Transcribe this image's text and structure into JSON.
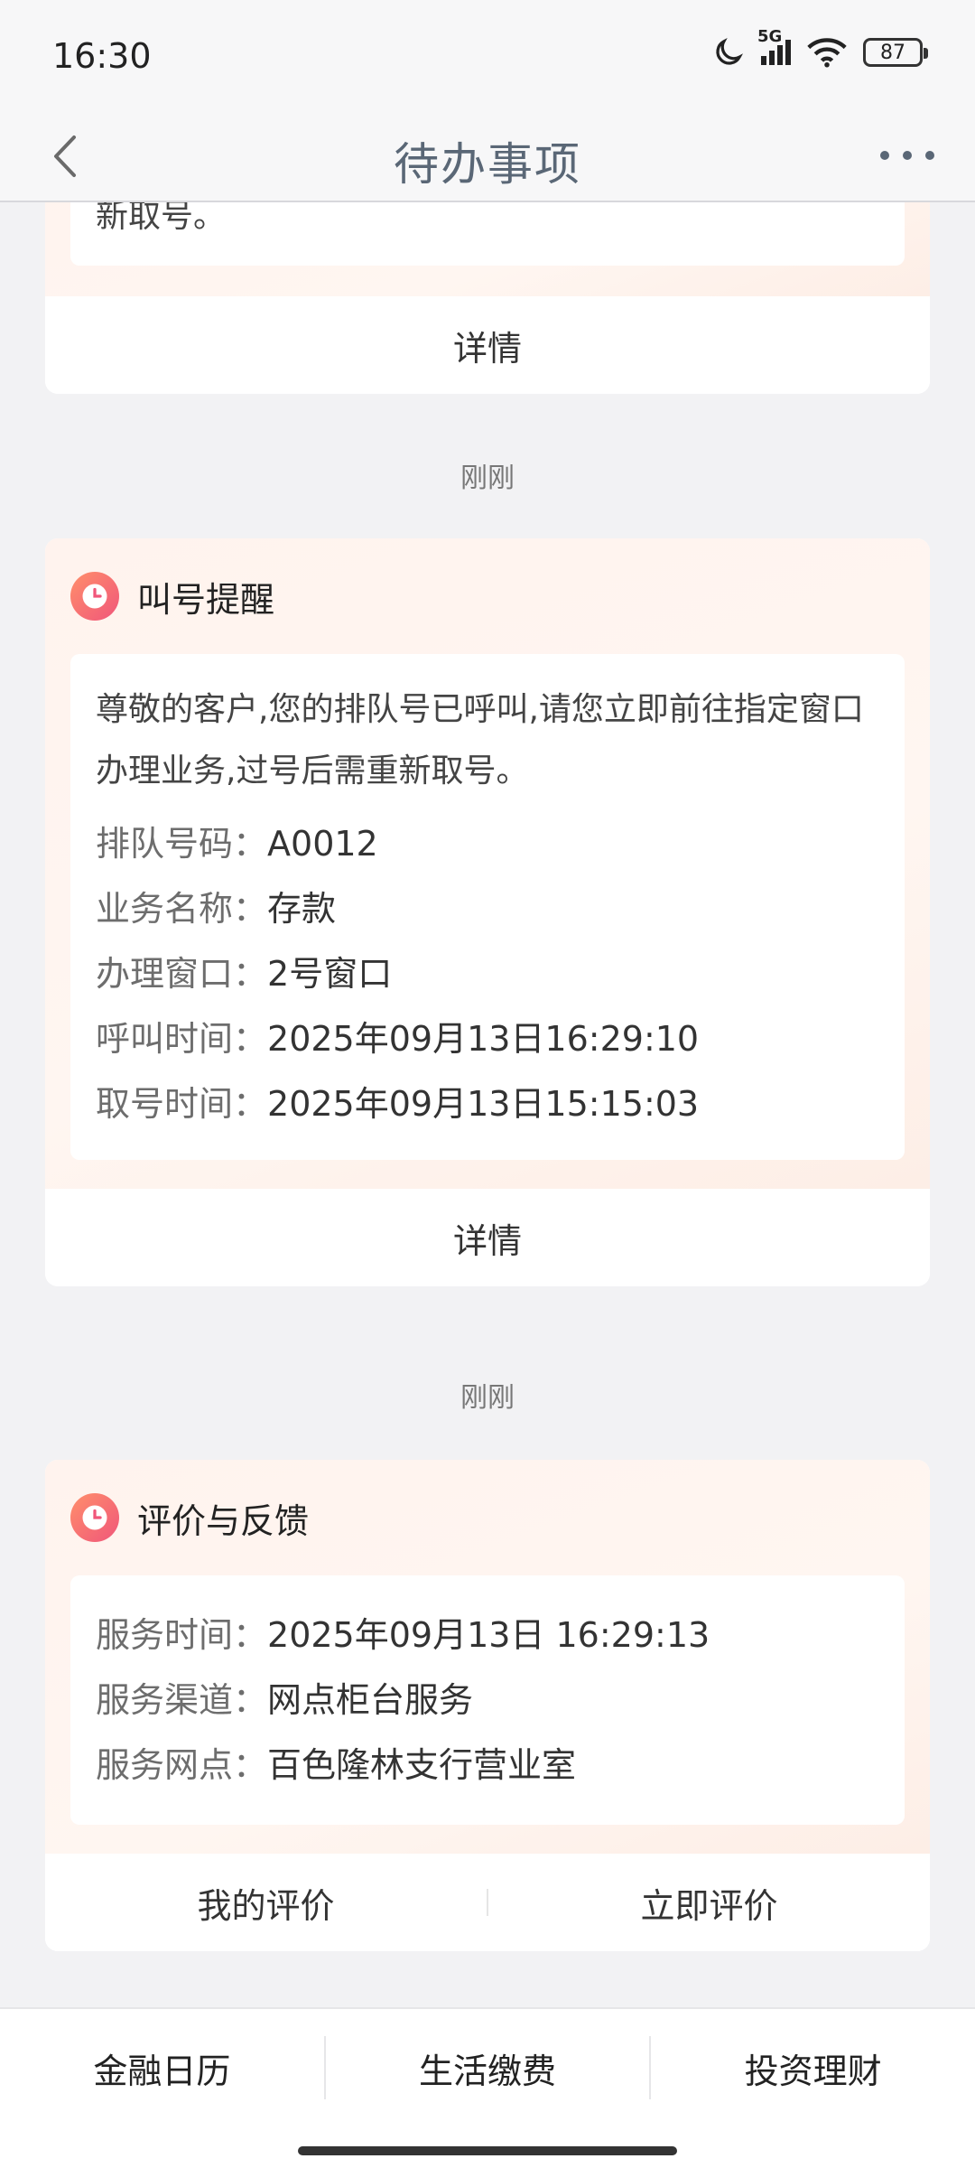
{
  "status_bar": {
    "time": "16:30",
    "network": "5G",
    "battery": "87"
  },
  "nav": {
    "title": "待办事项"
  },
  "prev_card": {
    "clipped_text": "新取号。",
    "detail_label": "详情"
  },
  "cards": [
    {
      "time_label": "刚刚",
      "title": "叫号提醒",
      "message": "尊敬的客户,您的排队号已呼叫,请您立即前往指定窗口办理业务,过号后需重新取号。",
      "fields": [
        {
          "label": "排队号码：",
          "value": "A0012"
        },
        {
          "label": "业务名称：",
          "value": "存款"
        },
        {
          "label": "办理窗口：",
          "value": "2号窗口"
        },
        {
          "label": "呼叫时间：",
          "value": "2025年09月13日16:29:10"
        },
        {
          "label": "取号时间：",
          "value": "2025年09月13日15:15:03"
        }
      ],
      "detail_label": "详情"
    },
    {
      "time_label": "刚刚",
      "title": "评价与反馈",
      "fields": [
        {
          "label": "服务时间：",
          "value": "2025年09月13日 16:29:13"
        },
        {
          "label": "服务渠道：",
          "value": "网点柜台服务"
        },
        {
          "label": "服务网点：",
          "value": "百色隆林支行营业室"
        }
      ],
      "actions": [
        "我的评价",
        "立即评价"
      ]
    }
  ],
  "bottom_tabs": [
    "金融日历",
    "生活缴费",
    "投资理财"
  ],
  "colors": {
    "accent_gradient_start": "#ff8f6b",
    "accent_gradient_end": "#f0567a",
    "title_color": "#5a6776"
  }
}
